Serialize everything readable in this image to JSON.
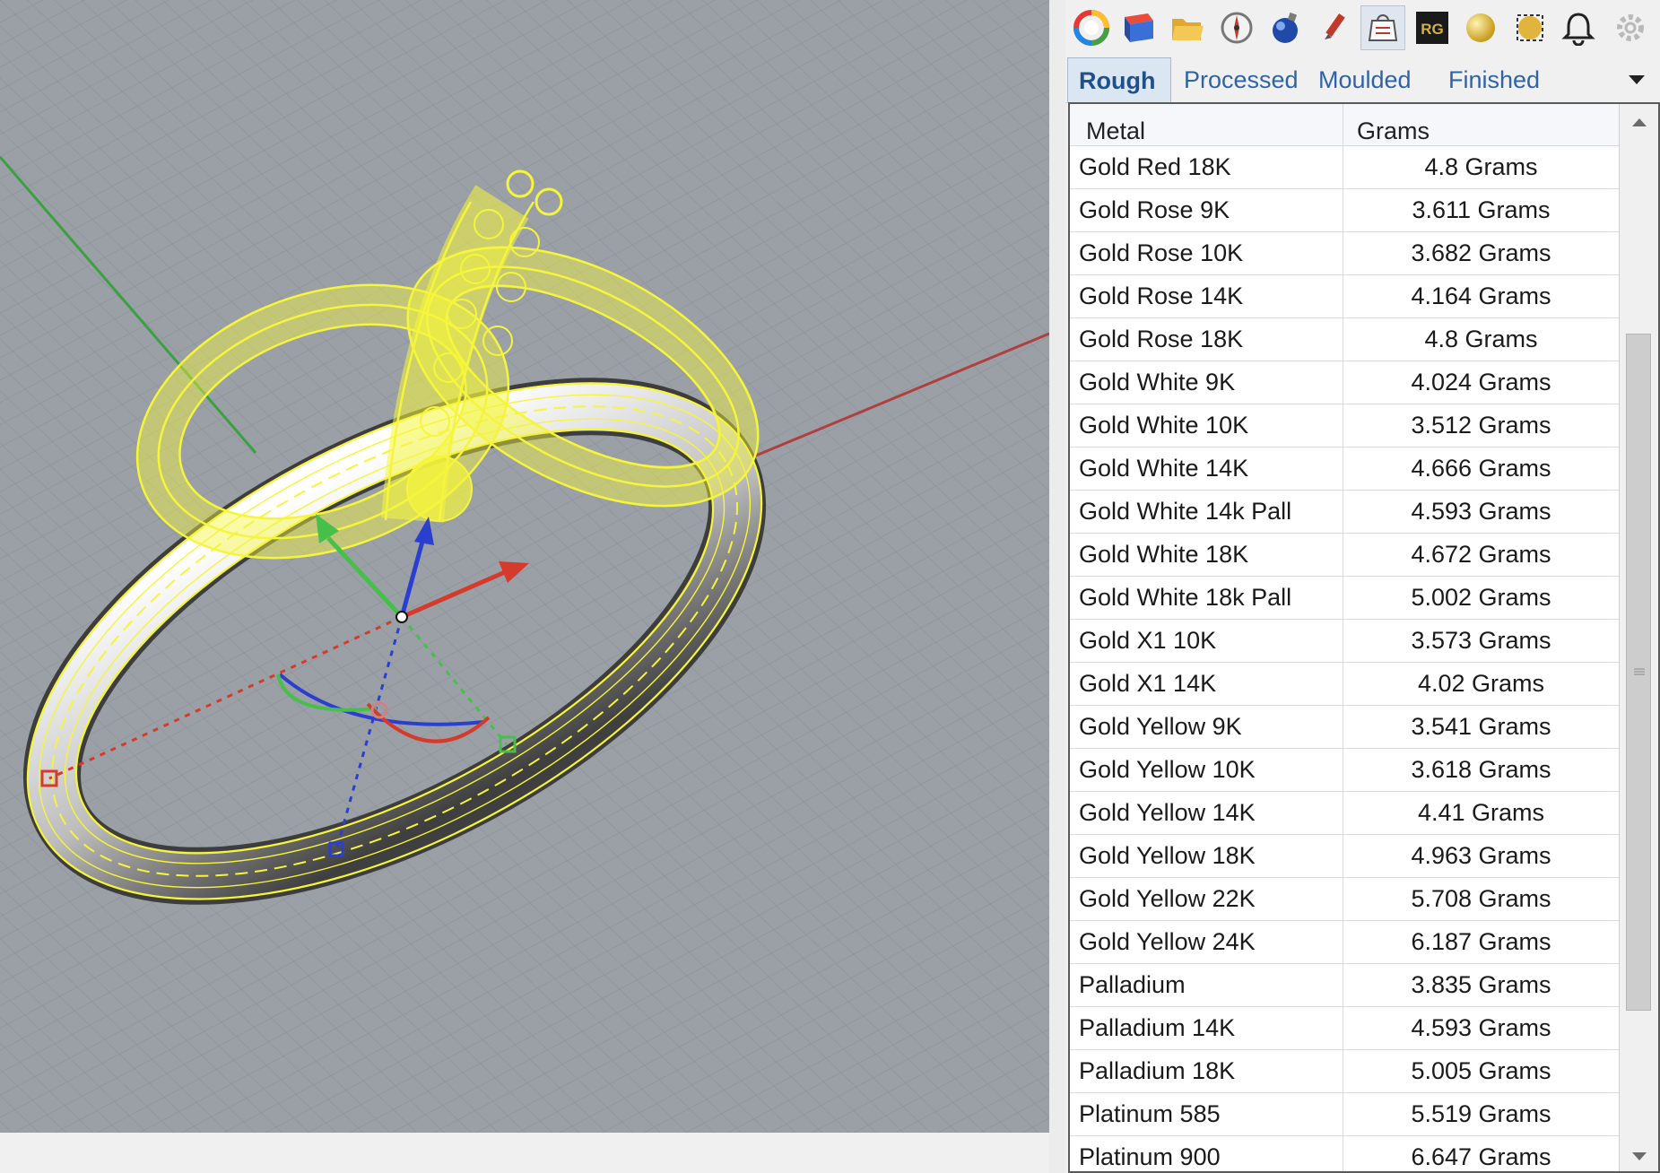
{
  "toolbar": {
    "icons": [
      "color-wheel-icon",
      "material-box-icon",
      "open-folder-icon",
      "compass-icon",
      "gem-ball-icon",
      "pen-brush-icon",
      "weight-icon",
      "rg-logo-icon",
      "gold-sphere-icon",
      "gold-cube-icon",
      "bell-icon",
      "settings-icon"
    ]
  },
  "tabs": [
    {
      "label": "Rough",
      "active": true
    },
    {
      "label": "Processed",
      "active": false
    },
    {
      "label": "Moulded",
      "active": false
    },
    {
      "label": "Finished",
      "active": false
    }
  ],
  "table": {
    "columns": {
      "metal": "Metal",
      "grams": "Grams"
    },
    "rows": [
      {
        "metal": "Gold Red 18K",
        "grams": "4.8 Grams"
      },
      {
        "metal": "Gold Rose 9K",
        "grams": "3.611 Grams"
      },
      {
        "metal": "Gold Rose 10K",
        "grams": "3.682 Grams"
      },
      {
        "metal": "Gold Rose 14K",
        "grams": "4.164 Grams"
      },
      {
        "metal": "Gold Rose 18K",
        "grams": "4.8 Grams"
      },
      {
        "metal": "Gold White 9K",
        "grams": "4.024 Grams"
      },
      {
        "metal": "Gold White 10K",
        "grams": "3.512 Grams"
      },
      {
        "metal": "Gold White 14K",
        "grams": "4.666 Grams"
      },
      {
        "metal": "Gold White 14k Pall",
        "grams": "4.593 Grams"
      },
      {
        "metal": "Gold White 18K",
        "grams": "4.672 Grams"
      },
      {
        "metal": "Gold White 18k Pall",
        "grams": "5.002 Grams"
      },
      {
        "metal": "Gold X1 10K",
        "grams": "3.573 Grams"
      },
      {
        "metal": "Gold X1 14K",
        "grams": "4.02 Grams"
      },
      {
        "metal": "Gold Yellow 9K",
        "grams": "3.541 Grams"
      },
      {
        "metal": "Gold Yellow 10K",
        "grams": "3.618 Grams"
      },
      {
        "metal": "Gold Yellow 14K",
        "grams": "4.41 Grams"
      },
      {
        "metal": "Gold Yellow 18K",
        "grams": "4.963 Grams"
      },
      {
        "metal": "Gold Yellow 22K",
        "grams": "5.708 Grams"
      },
      {
        "metal": "Gold Yellow 24K",
        "grams": "6.187 Grams"
      },
      {
        "metal": "Palladium",
        "grams": "3.835 Grams"
      },
      {
        "metal": "Palladium 14K",
        "grams": "4.593 Grams"
      },
      {
        "metal": "Palladium 18K",
        "grams": "5.005 Grams"
      },
      {
        "metal": "Platinum 585",
        "grams": "5.519 Grams"
      },
      {
        "metal": "Platinum 900",
        "grams": "6.647 Grams"
      }
    ]
  },
  "colors": {
    "viewport_bg": "#9aa0a6",
    "wireframe": "#f5f53c",
    "x_axis": "#c0392b",
    "y_axis": "#3aa040",
    "z_axis": "#2a3fd0",
    "tab_text": "#2f63a6"
  }
}
